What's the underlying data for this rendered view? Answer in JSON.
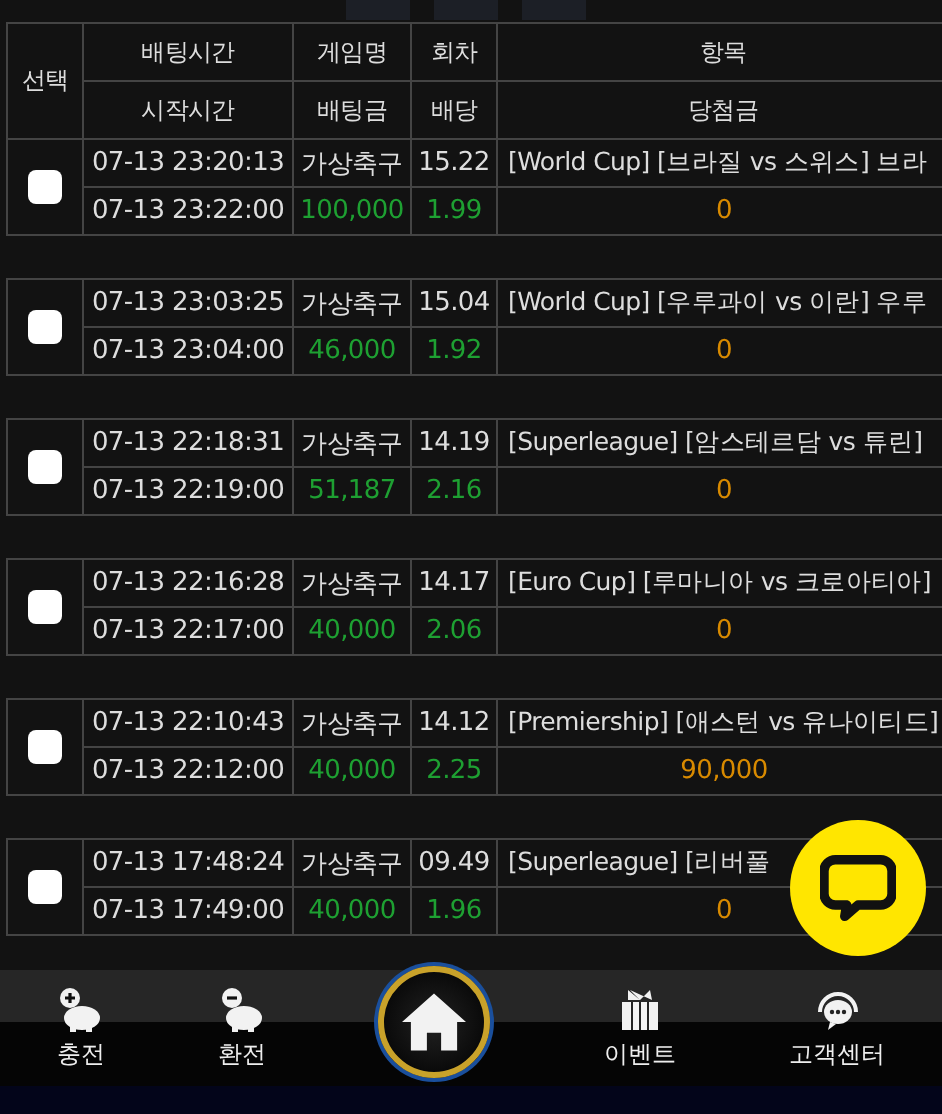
{
  "header": {
    "select": "선택",
    "row1": [
      "배팅시간",
      "게임명",
      "회차",
      "항목"
    ],
    "row2": [
      "시작시간",
      "배팅금",
      "배당",
      "당첨금"
    ]
  },
  "bets": [
    {
      "checked": false,
      "bet_time": "07-13 23:20:13",
      "game": "가상축구",
      "round": "15.22",
      "item": "[World Cup] [브라질 vs 스위스] 브라",
      "start_time": "07-13 23:22:00",
      "amount": "100,000",
      "odds": "1.99",
      "payout": "0"
    },
    {
      "checked": false,
      "bet_time": "07-13 23:03:25",
      "game": "가상축구",
      "round": "15.04",
      "item": "[World Cup] [우루과이 vs 이란] 우루",
      "start_time": "07-13 23:04:00",
      "amount": "46,000",
      "odds": "1.92",
      "payout": "0"
    },
    {
      "checked": false,
      "bet_time": "07-13 22:18:31",
      "game": "가상축구",
      "round": "14.19",
      "item": "[Superleague] [암스테르담 vs 튜린]",
      "start_time": "07-13 22:19:00",
      "amount": "51,187",
      "odds": "2.16",
      "payout": "0"
    },
    {
      "checked": false,
      "bet_time": "07-13 22:16:28",
      "game": "가상축구",
      "round": "14.17",
      "item": "[Euro Cup] [루마니아 vs 크로아티아]",
      "start_time": "07-13 22:17:00",
      "amount": "40,000",
      "odds": "2.06",
      "payout": "0"
    },
    {
      "checked": false,
      "bet_time": "07-13 22:10:43",
      "game": "가상축구",
      "round": "14.12",
      "item": "[Premiership] [애스턴 vs 유나이티드]",
      "start_time": "07-13 22:12:00",
      "amount": "40,000",
      "odds": "2.25",
      "payout": "90,000"
    },
    {
      "checked": false,
      "bet_time": "07-13 17:48:24",
      "game": "가상축구",
      "round": "09.49",
      "item": "[Superleague] [리버풀",
      "start_time": "07-13 17:49:00",
      "amount": "40,000",
      "odds": "1.96",
      "payout": "0"
    }
  ],
  "nav": [
    {
      "kind": "deposit",
      "label": "충전"
    },
    {
      "kind": "withdraw",
      "label": "환전"
    },
    {
      "kind": "home"
    },
    {
      "kind": "event",
      "label": "이벤트"
    },
    {
      "kind": "support",
      "label": "고객센터"
    }
  ]
}
